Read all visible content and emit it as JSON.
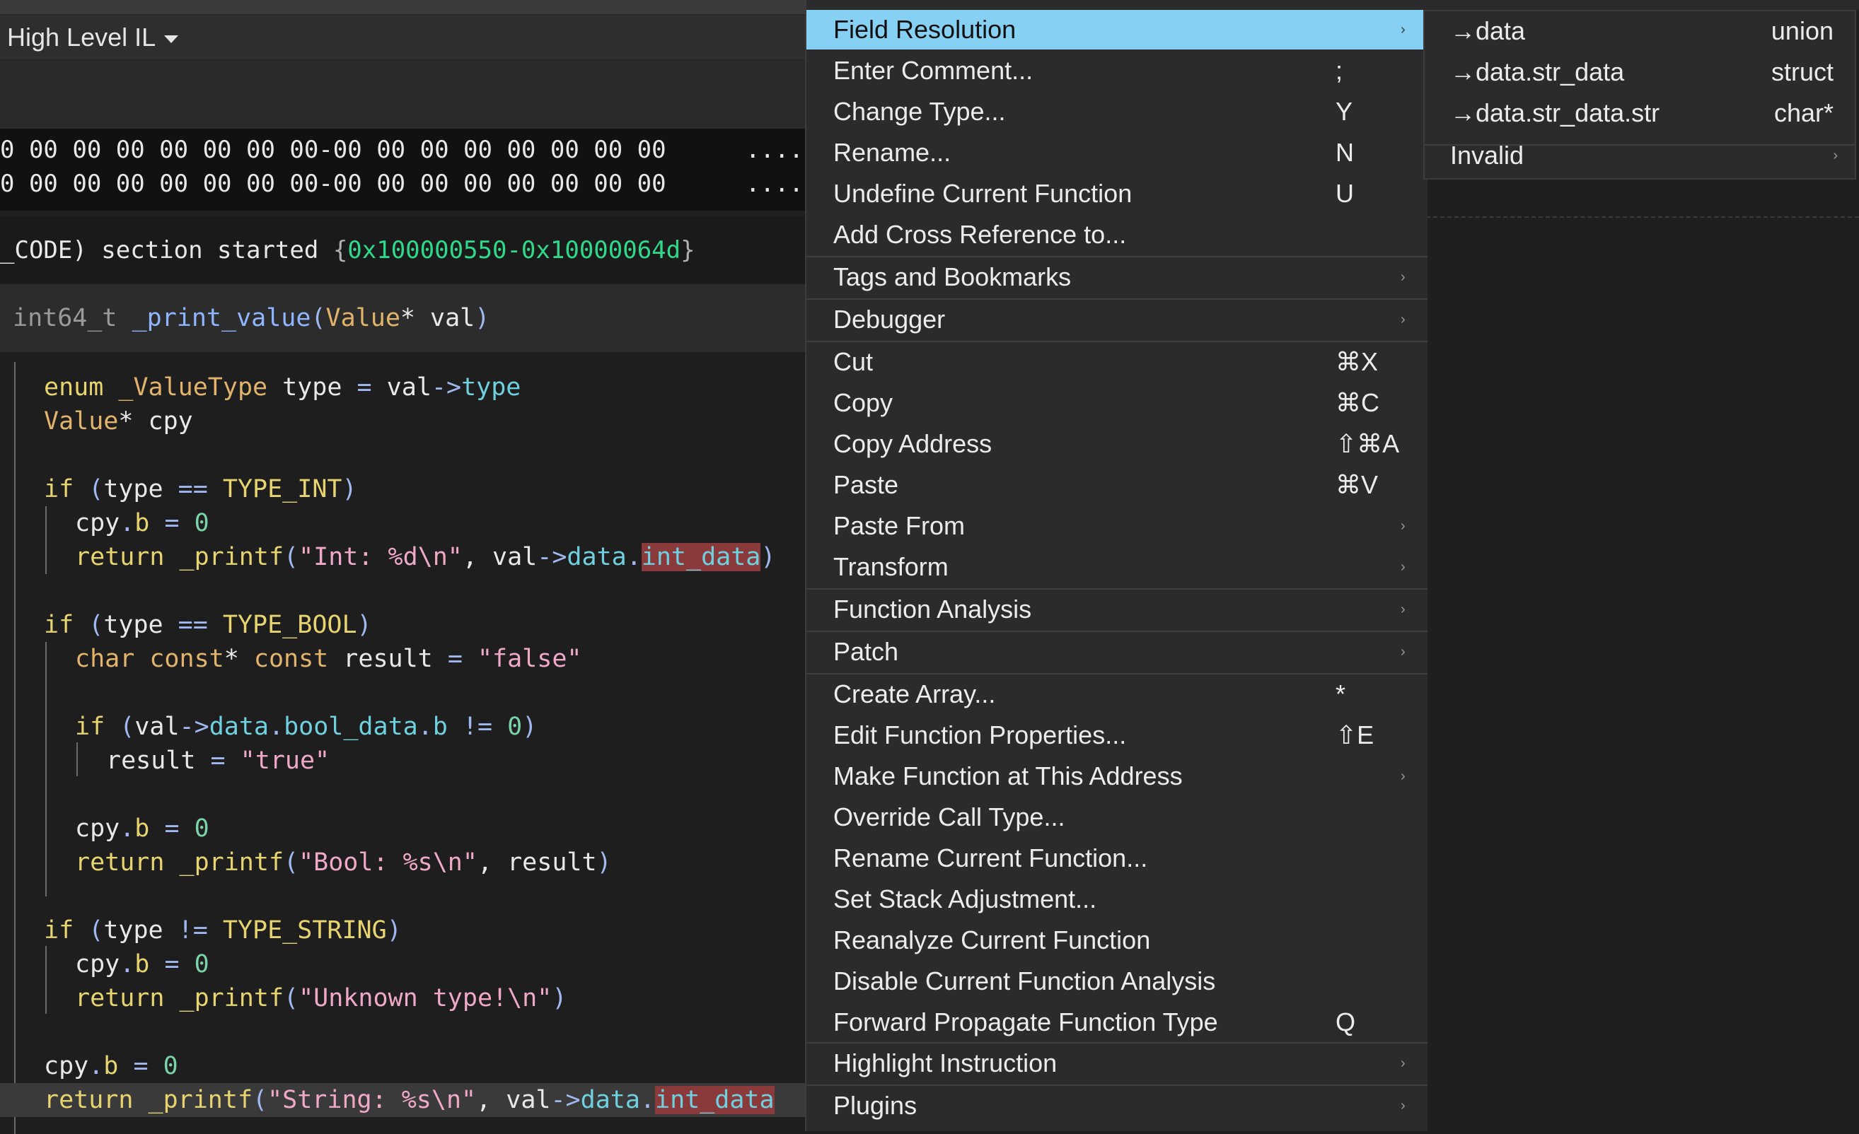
{
  "view": {
    "il_selector": "High Level IL"
  },
  "hex": [
    {
      "bytes": "0 00 00 00 00 00 00 00-00 00 00 00 00 00 00 00",
      "ascii": "...."
    },
    {
      "bytes": "0 00 00 00 00 00 00 00-00 00 00 00 00 00 00 00",
      "ascii": "...."
    }
  ],
  "log": {
    "prefix": "_CODE) section started ",
    "open": "{",
    "range": "0x100000550-0x10000064d",
    "close": "}"
  },
  "signature": {
    "ret": "int64_t ",
    "name": "_print_value",
    "open": "(",
    "ptype": "Value",
    "rest": "* val",
    "close": ")"
  },
  "code": {
    "l1": [
      "enum",
      " _ValueType",
      " type ",
      "=",
      " val",
      "->",
      "type"
    ],
    "l2": [
      "Value",
      "* cpy"
    ],
    "l4": [
      "if",
      " (",
      "type ",
      "==",
      " TYPE_INT",
      ")"
    ],
    "cpy_b": [
      "cpy",
      ".",
      "b",
      " = ",
      "0"
    ],
    "l6": [
      "return",
      " _printf",
      "(",
      "\"Int: %d\\n\"",
      ", val",
      "->",
      "data",
      ".",
      "int_data",
      ")"
    ],
    "l8": [
      "if",
      " (",
      "type ",
      "==",
      " TYPE_BOOL",
      ")"
    ],
    "l9": [
      "char const",
      "* ",
      "const",
      " result ",
      "=",
      " ",
      "\"false\""
    ],
    "l11": [
      "if",
      " (",
      "val",
      "->",
      "data",
      ".",
      "bool_data",
      ".",
      "b",
      " != ",
      "0",
      ")"
    ],
    "l12": [
      "result ",
      "=",
      " ",
      "\"true\""
    ],
    "l15": [
      "return",
      " _printf",
      "(",
      "\"Bool: %s\\n\"",
      ", result",
      ")"
    ],
    "l17": [
      "if",
      " (",
      "type ",
      "!=",
      " TYPE_STRING",
      ")"
    ],
    "l19": [
      "return",
      " _printf",
      "(",
      "\"Unknown type!\\n\"",
      ")"
    ],
    "l22": [
      "return",
      " _printf",
      "(",
      "\"String: %s\\n\"",
      ", val",
      "->",
      "data",
      ".",
      "int_data"
    ]
  },
  "menu": {
    "items": [
      {
        "label": "Field Resolution",
        "shortcut": "",
        "submenu": true,
        "selected": true
      },
      {
        "label": "Enter Comment...",
        "shortcut": ";"
      },
      {
        "label": "Change Type...",
        "shortcut": "Y"
      },
      {
        "label": "Rename...",
        "shortcut": "N"
      },
      {
        "label": "Undefine Current Function",
        "shortcut": "U"
      },
      {
        "label": "Add Cross Reference to...",
        "shortcut": ""
      },
      {
        "label": "Tags and Bookmarks",
        "shortcut": "",
        "submenu": true
      },
      {
        "label": "Debugger",
        "shortcut": "",
        "submenu": true
      },
      {
        "label": "Cut",
        "shortcut": "⌘X"
      },
      {
        "label": "Copy",
        "shortcut": "⌘C"
      },
      {
        "label": "Copy Address",
        "shortcut": "⇧⌘A"
      },
      {
        "label": "Paste",
        "shortcut": "⌘V"
      },
      {
        "label": "Paste From",
        "shortcut": "",
        "submenu": true
      },
      {
        "label": "Transform",
        "shortcut": "",
        "submenu": true
      },
      {
        "label": "Function Analysis",
        "shortcut": "",
        "submenu": true
      },
      {
        "label": "Patch",
        "shortcut": "",
        "submenu": true
      },
      {
        "label": "Create Array...",
        "shortcut": "*"
      },
      {
        "label": "Edit Function Properties...",
        "shortcut": "⇧E"
      },
      {
        "label": "Make Function at This Address",
        "shortcut": "",
        "submenu": true
      },
      {
        "label": "Override Call Type...",
        "shortcut": ""
      },
      {
        "label": "Rename Current Function...",
        "shortcut": ""
      },
      {
        "label": "Set Stack Adjustment...",
        "shortcut": ""
      },
      {
        "label": "Reanalyze Current Function",
        "shortcut": ""
      },
      {
        "label": "Disable Current Function Analysis",
        "shortcut": ""
      },
      {
        "label": "Forward Propagate Function Type",
        "shortcut": "Q"
      },
      {
        "label": "Highlight Instruction",
        "shortcut": "",
        "submenu": true
      },
      {
        "label": "Plugins",
        "shortcut": "",
        "submenu": true
      }
    ],
    "submenu_arrow": "›"
  },
  "field_submenu": [
    {
      "label": "→data",
      "type": "union"
    },
    {
      "label": "→data.str_data",
      "type": "struct"
    },
    {
      "label": "→data.str_data.str",
      "type": "char*"
    },
    {
      "label": "Invalid",
      "type": "",
      "submenu": true
    }
  ]
}
